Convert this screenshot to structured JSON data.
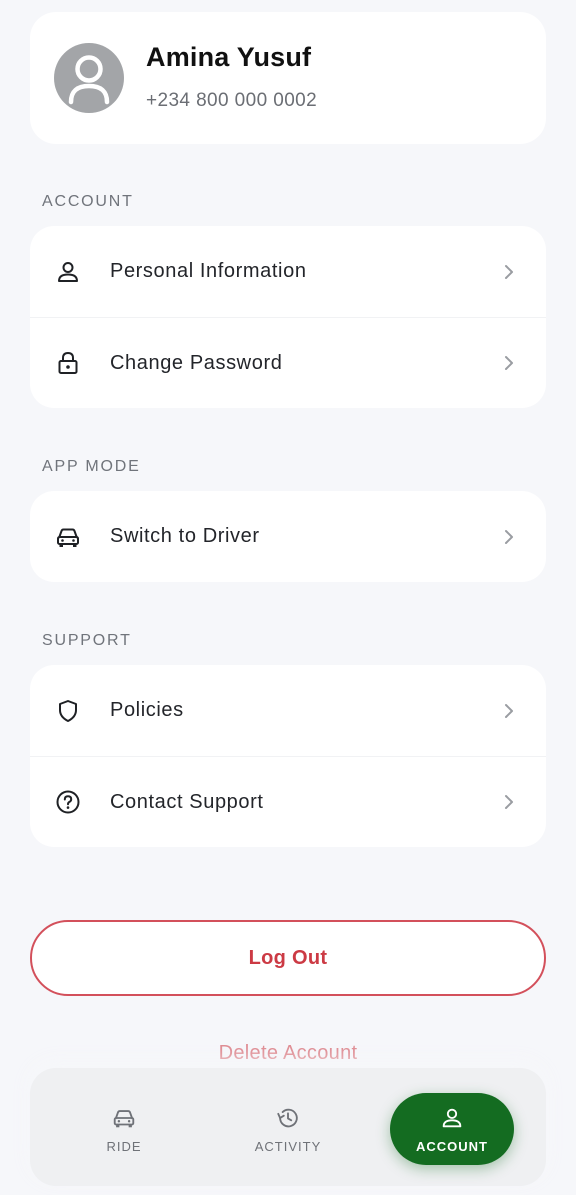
{
  "profile": {
    "name": "Amina Yusuf",
    "phone": "+234 800 000 0002"
  },
  "sections": {
    "account": {
      "label": "ACCOUNT",
      "items": [
        {
          "label": "Personal Information",
          "icon": "person-icon"
        },
        {
          "label": "Change Password",
          "icon": "lock-icon"
        }
      ]
    },
    "app_mode": {
      "label": "APP MODE",
      "items": [
        {
          "label": "Switch to Driver",
          "icon": "car-icon"
        }
      ]
    },
    "support": {
      "label": "SUPPORT",
      "items": [
        {
          "label": "Policies",
          "icon": "shield-icon"
        },
        {
          "label": "Contact Support",
          "icon": "help-icon"
        }
      ]
    }
  },
  "actions": {
    "logout_label": "Log Out",
    "delete_label": "Delete Account"
  },
  "nav": {
    "items": [
      {
        "label": "RIDE",
        "icon": "car-icon",
        "active": false
      },
      {
        "label": "ACTIVITY",
        "icon": "history-icon",
        "active": false
      },
      {
        "label": "ACCOUNT",
        "icon": "person-icon",
        "active": true
      }
    ]
  },
  "colors": {
    "accent_green": "#146c21",
    "danger_red": "#cc3a44",
    "background": "#f6f7fa"
  }
}
